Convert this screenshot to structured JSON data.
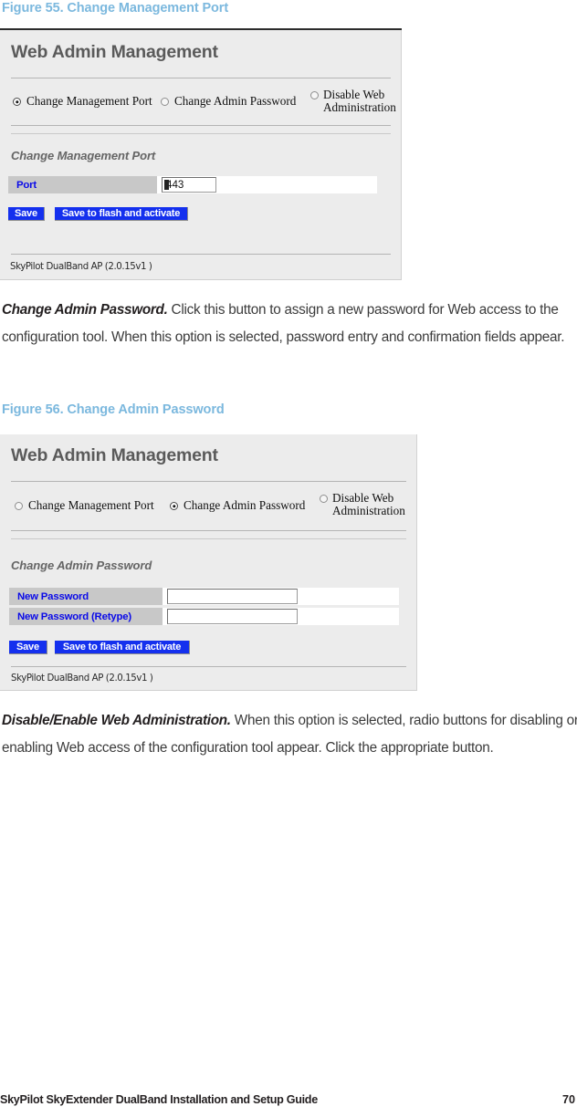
{
  "figure55": {
    "caption": "Figure 55. Change Management Port",
    "screenshot": {
      "title": "Web Admin Management",
      "radios": [
        {
          "label": "Change Management Port",
          "selected": true
        },
        {
          "label": "Change Admin Password",
          "selected": false
        },
        {
          "label": "Disable Web Administration",
          "selected": false
        }
      ],
      "section_title": "Change Management Port",
      "fields": [
        {
          "label": "Port",
          "value": "443"
        }
      ],
      "buttons": [
        {
          "label": "Save"
        },
        {
          "label": "Save to flash and activate"
        }
      ],
      "footer": "SkyPilot DualBand AP (2.0.15v1 )"
    }
  },
  "paragraph1": {
    "lead": "Change Admin Password.",
    "text": " Click this button to assign a new password for Web access to the configuration tool. When this option is selected, password entry and confirmation fields appear."
  },
  "figure56": {
    "caption": "Figure 56. Change Admin Password",
    "screenshot": {
      "title": "Web Admin Management",
      "radios": [
        {
          "label": "Change Management Port",
          "selected": false
        },
        {
          "label": "Change Admin Password",
          "selected": true
        },
        {
          "label": "Disable Web Administration",
          "selected": false
        }
      ],
      "section_title": "Change Admin Password",
      "fields": [
        {
          "label": "New Password",
          "value": ""
        },
        {
          "label": "New Password (Retype)",
          "value": ""
        }
      ],
      "buttons": [
        {
          "label": "Save"
        },
        {
          "label": "Save to flash and activate"
        }
      ],
      "footer": "SkyPilot DualBand AP (2.0.15v1 )"
    }
  },
  "paragraph2": {
    "lead": "Disable/Enable Web Administration.",
    "text": " When this option is selected, radio buttons for disabling or enabling Web access of the configuration tool appear. Click the appropriate button."
  },
  "footer": {
    "guide_title": "SkyPilot SkyExtender DualBand Installation and Setup Guide",
    "page_number": "70"
  },
  "colors": {
    "caption_blue": "#7bb8de",
    "label_blue": "#0a0ae8",
    "button_blue": "#1430ee",
    "panel_gray": "#ececec",
    "label_cell_gray": "#c8c8c8"
  }
}
